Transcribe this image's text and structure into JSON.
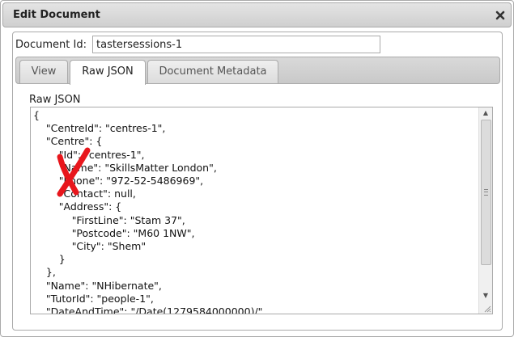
{
  "dialog": {
    "title": "Edit Document",
    "close_icon": "close-icon"
  },
  "document_id": {
    "label": "Document Id:",
    "value": "tastersessions-1"
  },
  "tabs": [
    {
      "label": "View",
      "active": false
    },
    {
      "label": "Raw JSON",
      "active": true
    },
    {
      "label": "Document Metadata",
      "active": false
    }
  ],
  "raw_json": {
    "label": "Raw JSON",
    "text": "{\n\t\"CentreId\": \"centres-1\",\n\t\"Centre\": {\n\t\t\"Id\": \"centres-1\",\n\t\t\"Name\": \"SkillsMatter London\",\n\t\t\"Phone\": \"972-52-5486969\",\n\t\t\"Contact\": null,\n\t\t\"Address\": {\n\t\t\t\"FirstLine\": \"Stam 37\",\n\t\t\t\"Postcode\": \"M60 1NW\",\n\t\t\t\"City\": \"Shem\"\n\t\t}\n\t},\n\t\"Name\": \"NHibernate\",\n\t\"TutorId\": \"people-1\",\n\t\"DateAndTime\": \"/Date(1279584000000)/\","
  },
  "annotation_color": "#e8161c"
}
